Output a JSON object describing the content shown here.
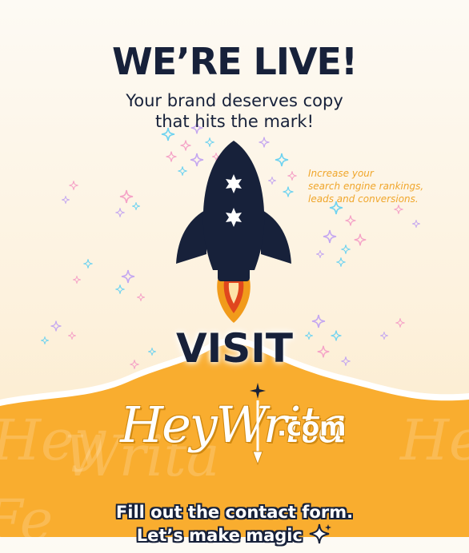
{
  "poster": {
    "headline": "WE’RE LIVE!",
    "subheadline_line1": "Your brand deserves copy",
    "subheadline_line2": "that hits the mark!",
    "side_note_line1": "Increase your",
    "side_note_line2": "search engine rankings,",
    "side_note_line3": "leads and conversions.",
    "visit_label": "VISIT",
    "brand_script": "HeyWrita",
    "brand_domain": ".com",
    "cta_line1": "Fill out the contact form.",
    "cta_line2": "Let’s make magic"
  },
  "colors": {
    "navy": "#17213a",
    "orange": "#f9ad2f",
    "flame_outer": "#f19b1b",
    "flame_inner": "#e0461e",
    "side_note": "#f0a62b",
    "sparkle_blue": "#6fd3f0",
    "sparkle_pink": "#f5a3c7",
    "sparkle_purple": "#c5a8f0"
  },
  "icons": [
    "rocket-icon",
    "sparkle-icon",
    "pen-nib-icon"
  ]
}
